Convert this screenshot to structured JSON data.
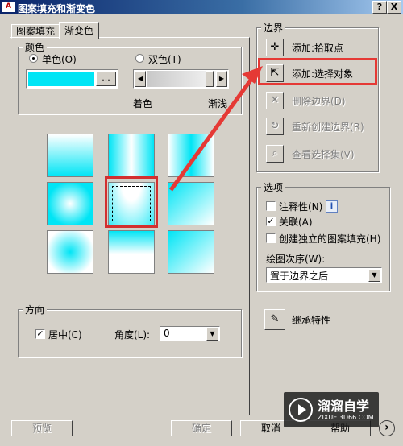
{
  "window": {
    "title": "图案填充和渐变色",
    "help_label": "?",
    "close_label": "X"
  },
  "tabs": [
    {
      "label": "图案填充",
      "active": false
    },
    {
      "label": "渐变色",
      "active": true
    }
  ],
  "color_group": {
    "title": "颜色",
    "single_label": "单色(O)",
    "double_label": "双色(T)",
    "single_selected": true,
    "single_color": "#00e5f5",
    "browse_label": "...",
    "shade_label": "着色",
    "tint_label": "渐浅",
    "slider_level": 0.96
  },
  "gradient_swatches": [
    {
      "pattern": "linear",
      "selected": false
    },
    {
      "pattern": "cylinder",
      "selected": false
    },
    {
      "pattern": "invcylinder",
      "selected": false
    },
    {
      "pattern": "spherical",
      "selected": false
    },
    {
      "pattern": "hemispherical",
      "selected": true
    },
    {
      "pattern": "curved",
      "selected": false
    },
    {
      "pattern": "invspherical",
      "selected": false
    },
    {
      "pattern": "invhemispherical",
      "selected": false
    },
    {
      "pattern": "invcurved",
      "selected": false
    }
  ],
  "orientation_group": {
    "title": "方向",
    "centered_label": "居中(C)",
    "centered_checked": true,
    "angle_label": "角度(L):",
    "angle_value": "0"
  },
  "boundaries_group": {
    "title": "边界",
    "add_pick_points": "添加:拾取点",
    "add_select_objects": "添加:选择对象",
    "remove_boundaries": "删除边界(D)",
    "recreate_boundary": "重新创建边界(R)",
    "view_selections": "查看选择集(V)"
  },
  "options_group": {
    "title": "选项",
    "annotative_label": "注释性(N)",
    "annotative_checked": false,
    "info_label": "i",
    "associative_label": "关联(A)",
    "associative_checked": true,
    "separate_label": "创建独立的图案填充(H)",
    "separate_checked": false,
    "draw_order_label": "绘图次序(W):",
    "draw_order_value": "置于边界之后"
  },
  "inherit_label": "继承特性",
  "footer": {
    "preview_label": "预览",
    "ok_label": "确定",
    "cancel_label": "取消",
    "help_label": "帮助",
    "more_label": "›"
  },
  "watermark": {
    "brand": "溜溜自学",
    "url": "ZIXUE.3D66.COM"
  },
  "colors": {
    "accent": "#00e5f5",
    "highlight": "#e53935",
    "arrow": "#e53935"
  }
}
